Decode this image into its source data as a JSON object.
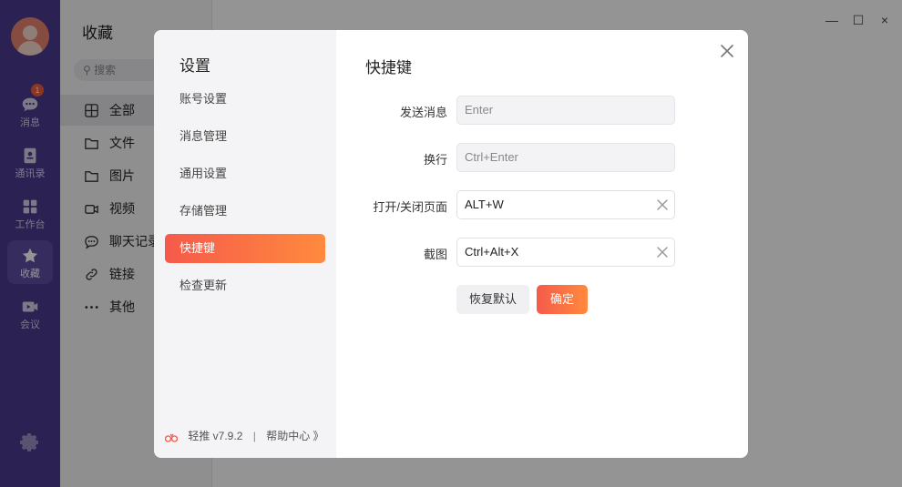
{
  "rail": {
    "items": [
      {
        "label": "消息",
        "badge": "1"
      },
      {
        "label": "通讯录"
      },
      {
        "label": "工作台"
      },
      {
        "label": "收藏"
      },
      {
        "label": "会议"
      }
    ]
  },
  "favorites": {
    "title": "收藏",
    "search_placeholder": "搜索",
    "items": [
      {
        "label": "全部"
      },
      {
        "label": "文件"
      },
      {
        "label": "图片"
      },
      {
        "label": "视频"
      },
      {
        "label": "聊天记录"
      },
      {
        "label": "链接"
      },
      {
        "label": "其他"
      }
    ]
  },
  "window": {
    "minimize": "—",
    "maximize": "☐",
    "close": "×"
  },
  "settings": {
    "title": "设置",
    "nav": [
      {
        "label": "账号设置"
      },
      {
        "label": "消息管理"
      },
      {
        "label": "通用设置"
      },
      {
        "label": "存储管理"
      },
      {
        "label": "快捷键"
      },
      {
        "label": "检查更新"
      }
    ],
    "footer": {
      "app": "轻推 v7.9.2",
      "separator": "|",
      "help": "帮助中心 》"
    }
  },
  "shortcuts": {
    "title": "快捷键",
    "rows": [
      {
        "label": "发送消息",
        "value": "Enter"
      },
      {
        "label": "换行",
        "value": "Ctrl+Enter"
      },
      {
        "label": "打开/关闭页面",
        "value": "ALT+W"
      },
      {
        "label": "截图",
        "value": "Ctrl+Alt+X"
      }
    ],
    "reset_label": "恢复默认",
    "ok_label": "确定"
  },
  "colors": {
    "rail": "#4b3a8f",
    "accent_start": "#f65a4a",
    "accent_end": "#ff8a3e",
    "badge": "#f25c3c"
  }
}
